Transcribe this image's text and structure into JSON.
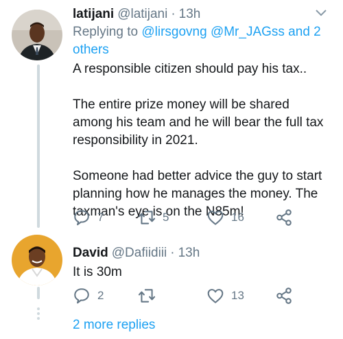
{
  "tweets": [
    {
      "name": "latijani",
      "handle": "@latijani",
      "separator": "·",
      "time": "13h",
      "replying_prefix": "Replying to",
      "replying_targets": "@lirsgovng @Mr_JAGss and 2 others",
      "text": "A responsible citizen should pay his tax..\n\nThe entire prize money will be shared among his team and he will bear the full tax responsibility in 2021.\n\nSomeone had better advice the guy to start planning how he manages the money.  The taxman's eye is on the N85m!",
      "reply_count": "7",
      "retweet_count": "5",
      "like_count": "16"
    },
    {
      "name": "David",
      "handle": "@Dafiidiii",
      "separator": "·",
      "time": "13h",
      "text": "It is 30m",
      "reply_count": "2",
      "retweet_count": "",
      "like_count": "13"
    }
  ],
  "more_replies": "2 more replies",
  "icons": {
    "reply": "reply-icon",
    "retweet": "retweet-icon",
    "like": "like-icon",
    "share": "share-icon",
    "menu": "chevron-down-icon"
  },
  "colors": {
    "link": "#1da1f2",
    "muted": "#657786",
    "thread_line": "#cfd9de"
  }
}
